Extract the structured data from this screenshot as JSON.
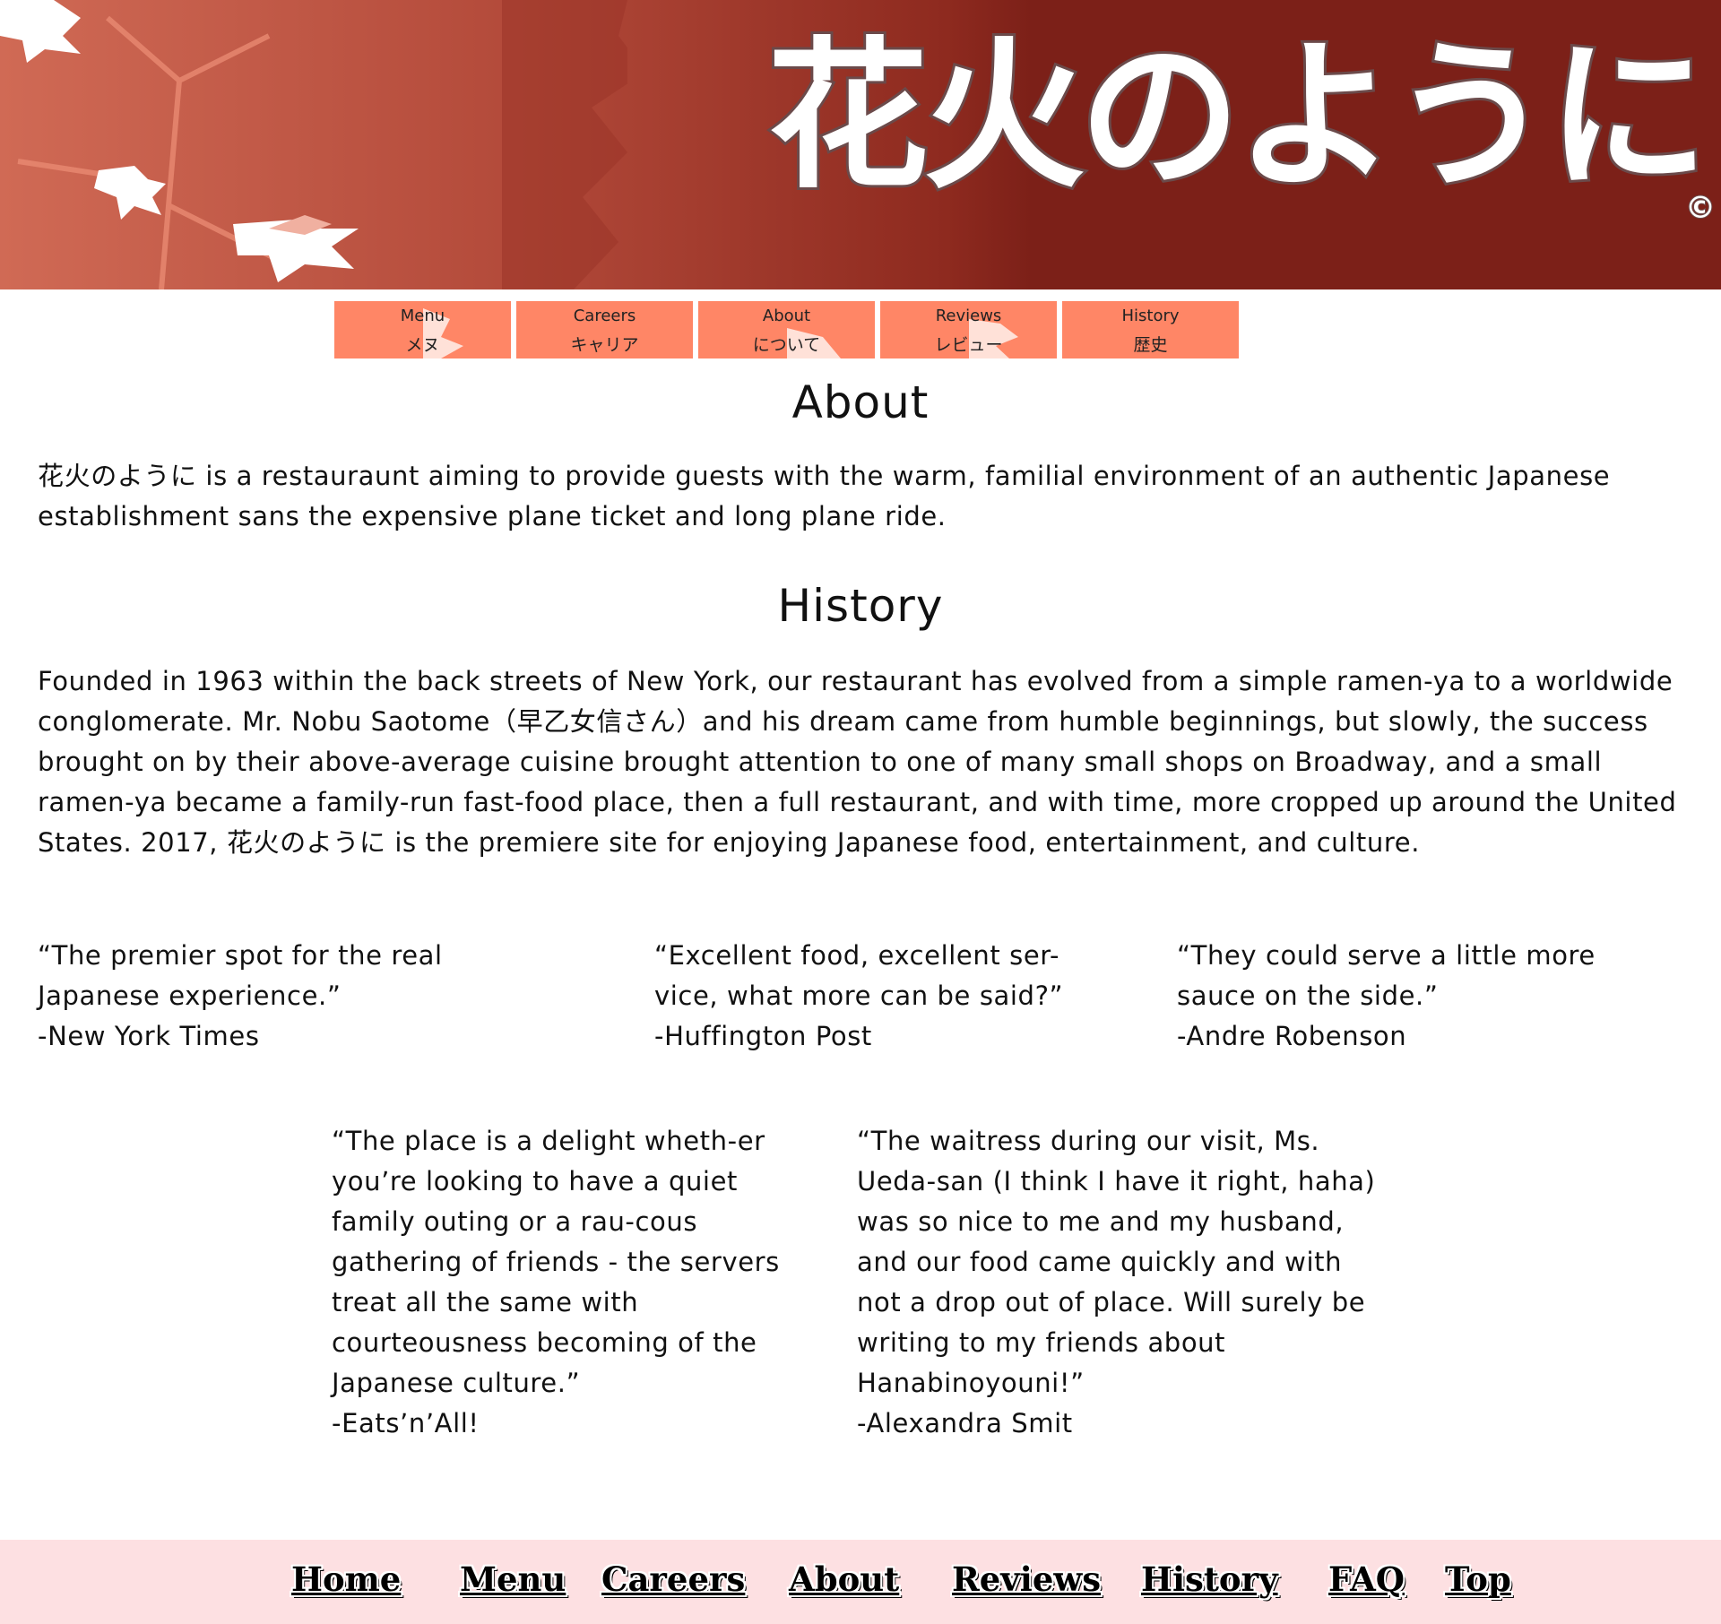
{
  "banner": {
    "title": "花火のように",
    "copyright": "©"
  },
  "topnav": [
    {
      "en": "Menu",
      "jp": "メヌ"
    },
    {
      "en": "Careers",
      "jp": "キャリア"
    },
    {
      "en": "About",
      "jp": "について"
    },
    {
      "en": "Reviews",
      "jp": "レビュー"
    },
    {
      "en": "History",
      "jp": "歴史"
    }
  ],
  "about": {
    "title": "About",
    "text": "花火のように is a restauraunt aiming to provide guests with the warm, familial environment of an authentic Japanese establishment sans the expensive plane ticket and long plane ride."
  },
  "history": {
    "title": "History",
    "text": "Founded in 1963 within the back streets of New York, our restaurant has evolved from a simple ramen-ya to a worldwide conglomerate. Mr. Nobu Saotome（早乙女信さん）and his dream came from humble beginnings, but slowly, the success brought on by their above-average cuisine brought attention to one of many small shops on Broadway, and a small ramen-ya became a family-run fast-food place, then a full restaurant, and with time, more cropped up around the United States. 2017, 花火のように is the premiere site for enjoying Japanese food, entertainment, and culture."
  },
  "reviews": [
    {
      "quote": "“The premier spot for the real Japanese experience.”",
      "source": "-New York Times"
    },
    {
      "quote": "“Excellent food, excellent ser-vice, what more can be said?”",
      "source": "-Huffington Post"
    },
    {
      "quote": "“They could serve a little more sauce on the side.”",
      "source": "-Andre Robenson"
    },
    {
      "quote": "“The place is a delight wheth-er you’re looking to have a quiet family outing or a rau-cous gathering of friends - the servers treat all the same with courteousness becoming of the Japanese culture.”",
      "source": "-Eats’n’All!"
    },
    {
      "quote": "“The waitress during our visit, Ms. Ueda-san (I think I have it right, haha) was so nice to me and my husband, and our food came quickly and with not a drop out of place. Will surely be writing to my friends about Hanabinoyouni!”",
      "source": "-Alexandra Smit"
    }
  ],
  "footer": [
    "Home",
    "Menu",
    "Careers",
    "About",
    "Reviews",
    "History",
    "FAQ",
    "Top"
  ],
  "colors": {
    "banner_dark": "#7c2018",
    "tile": "#ff8666",
    "footer_bg": "#fde0e2"
  }
}
